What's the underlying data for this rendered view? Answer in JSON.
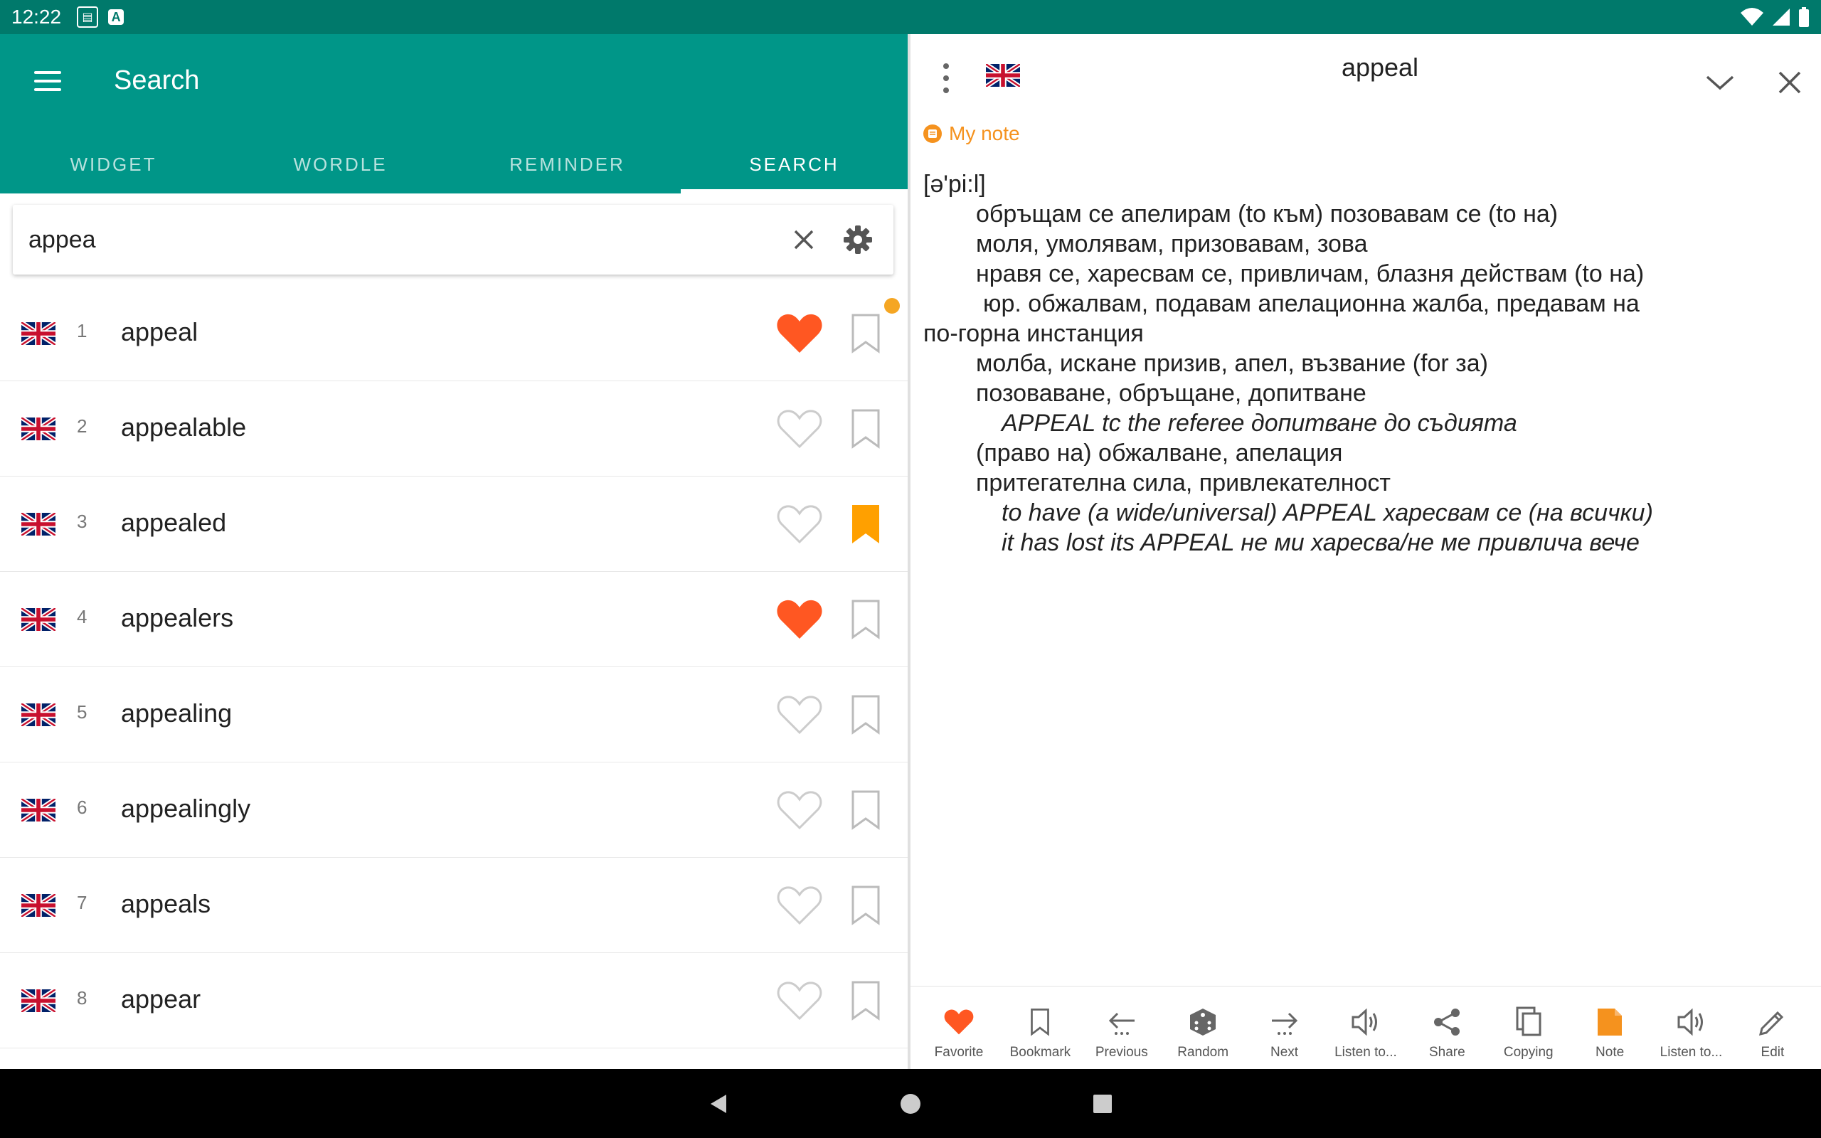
{
  "status_bar": {
    "time": "12:22"
  },
  "app_bar": {
    "title": "Search"
  },
  "tabs": [
    {
      "label": "WIDGET"
    },
    {
      "label": "WORDLE"
    },
    {
      "label": "REMINDER"
    },
    {
      "label": "SEARCH",
      "active": true
    }
  ],
  "search": {
    "value": "appea"
  },
  "results": [
    {
      "num": "1",
      "word": "appeal",
      "favorite": true,
      "bookmarked": false,
      "has_note": true
    },
    {
      "num": "2",
      "word": "appealable",
      "favorite": false,
      "bookmarked": false
    },
    {
      "num": "3",
      "word": "appealed",
      "favorite": false,
      "bookmarked": true
    },
    {
      "num": "4",
      "word": "appealers",
      "favorite": true,
      "bookmarked": false
    },
    {
      "num": "5",
      "word": "appealing",
      "favorite": false,
      "bookmarked": false
    },
    {
      "num": "6",
      "word": "appealingly",
      "favorite": false,
      "bookmarked": false
    },
    {
      "num": "7",
      "word": "appeals",
      "favorite": false,
      "bookmarked": false
    },
    {
      "num": "8",
      "word": "appear",
      "favorite": false,
      "bookmarked": false
    }
  ],
  "detail": {
    "title": "appeal",
    "my_note_label": "My note",
    "lines": [
      {
        "text": "[ə'pi:l]",
        "style": "plain"
      },
      {
        "text": "обръщам се апелирам (to към) позовавам се (to на)",
        "style": "indent"
      },
      {
        "text": "моля, умолявам, призовавам, зова",
        "style": "indent"
      },
      {
        "text": "нравя се, харесвам се, привличам, блазня действам (to на)",
        "style": "indent"
      },
      {
        "text": "юр. обжалвам, подавам апелационна жалба, предавам на",
        "style": "indent0"
      },
      {
        "text": "по-горна инстанция",
        "style": "plain"
      },
      {
        "text": "молба, искане призив, апел, възвание (for за)",
        "style": "indent"
      },
      {
        "text": "позоваване, обръщане, допитване",
        "style": "indent"
      },
      {
        "text": "APPEAL tc the referee допитване до съдията",
        "style": "example"
      },
      {
        "text": "(право на) обжалване, апелация",
        "style": "indent"
      },
      {
        "text": "притегателна сила, привлекателност",
        "style": "indent"
      },
      {
        "text": "to have (a wide/universal) APPEAL харесвам се (на всички)",
        "style": "example"
      },
      {
        "text": "it has lost its APPEAL не ми харесва/не ме привлича вече",
        "style": "example"
      }
    ]
  },
  "bottom_bar": [
    {
      "label": "Favorite",
      "icon": "heart-icon"
    },
    {
      "label": "Bookmark",
      "icon": "bookmark-icon"
    },
    {
      "label": "Previous",
      "icon": "arrow-left-icon"
    },
    {
      "label": "Random",
      "icon": "dice-icon"
    },
    {
      "label": "Next",
      "icon": "arrow-right-icon"
    },
    {
      "label": "Listen to...",
      "icon": "speaker-icon"
    },
    {
      "label": "Share",
      "icon": "share-icon"
    },
    {
      "label": "Copying",
      "icon": "copy-icon"
    },
    {
      "label": "Note",
      "icon": "note-icon"
    },
    {
      "label": "Listen to...",
      "icon": "speaker-icon"
    },
    {
      "label": "Edit",
      "icon": "pencil-icon"
    }
  ],
  "colors": {
    "status_bar": "#00796b",
    "app_bar": "#009688",
    "favorite": "#ff5722",
    "bookmark_active": "#ffa000",
    "note": "#f5921e"
  }
}
